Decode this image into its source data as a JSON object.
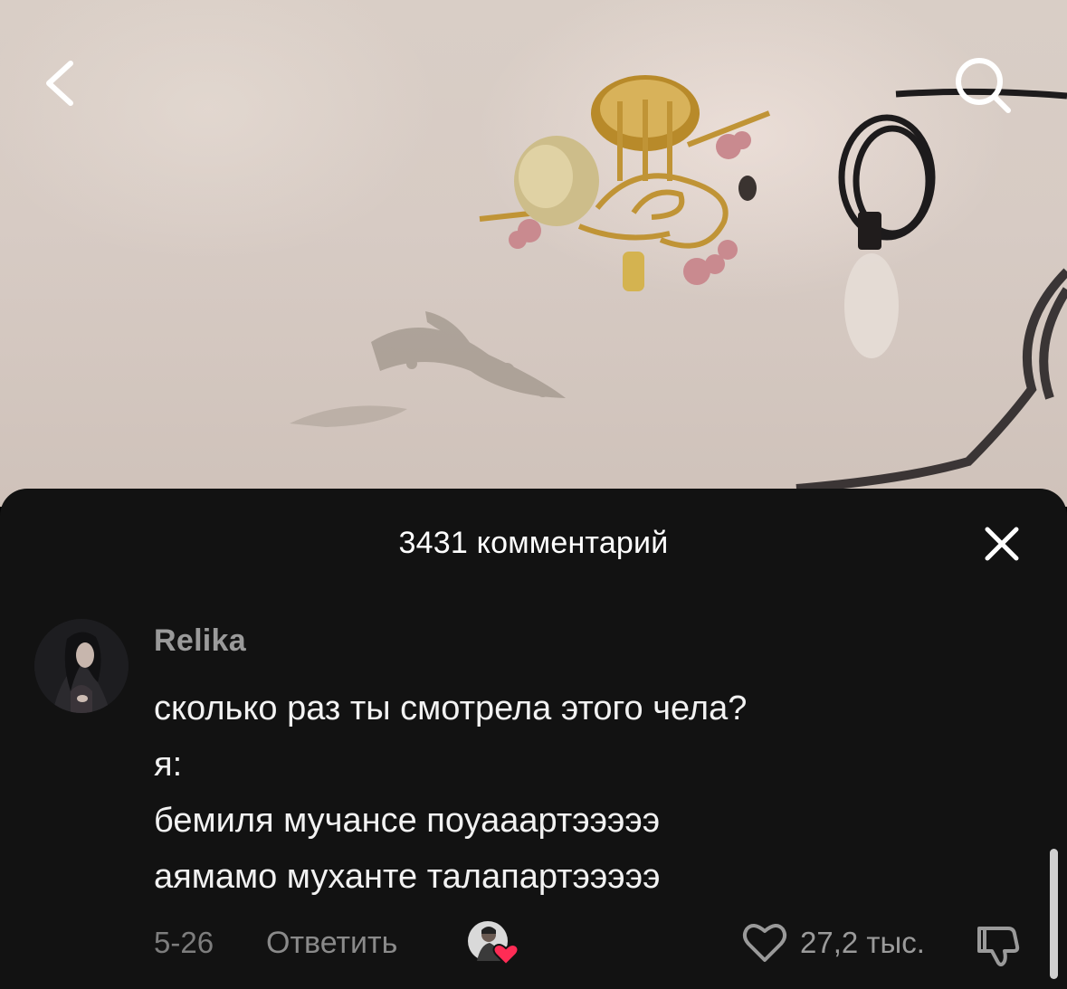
{
  "header": {
    "back_icon": "chevron-left-icon",
    "search_icon": "search-icon"
  },
  "sheet": {
    "title": "3431 комментарий",
    "close_icon": "close-icon"
  },
  "comment": {
    "username": "Relika",
    "lines": [
      "сколько раз ты смотрела этого чела?",
      "я:",
      "бемиля мучансе поуааартэээээ",
      "аямамо муханте талапартэээээ"
    ],
    "date": "5-26",
    "reply_label": "Ответить",
    "likes": "27,2 тыс.",
    "liked_by_creator_icon": "creator-heart-icon",
    "like_icon": "heart-outline-icon",
    "dislike_icon": "thumbs-down-icon"
  },
  "colors": {
    "sheet_bg": "#121212",
    "heart_red": "#fe2c55",
    "muted_text": "#9a9a9a"
  }
}
